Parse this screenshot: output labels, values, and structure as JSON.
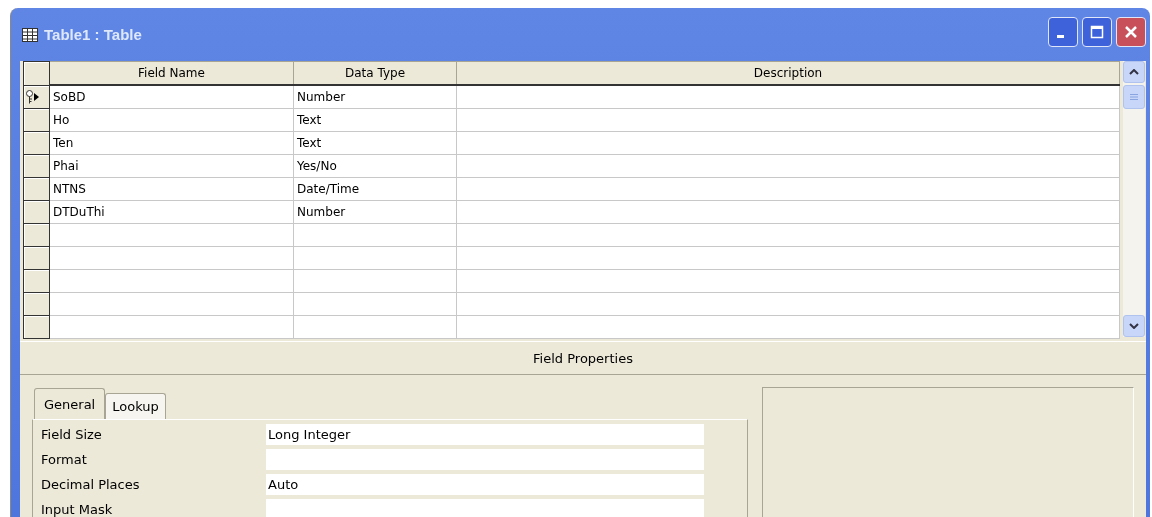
{
  "window": {
    "title": "Table1 : Table"
  },
  "grid": {
    "columns": [
      "Field Name",
      "Data Type",
      "Description"
    ],
    "rows": [
      {
        "field_name": "SoBD",
        "data_type": "Number",
        "primary_key": true,
        "current": true
      },
      {
        "field_name": "Ho",
        "data_type": "Text",
        "primary_key": false,
        "current": false
      },
      {
        "field_name": "Ten",
        "data_type": "Text",
        "primary_key": false,
        "current": false
      },
      {
        "field_name": "Phai",
        "data_type": "Yes/No",
        "primary_key": false,
        "current": false
      },
      {
        "field_name": "NTNS",
        "data_type": "Date/Time",
        "primary_key": false,
        "current": false
      },
      {
        "field_name": "DTDuThi",
        "data_type": "Number",
        "primary_key": false,
        "current": false
      }
    ]
  },
  "field_properties": {
    "title": "Field Properties",
    "tabs": [
      {
        "label": "General",
        "selected": true
      },
      {
        "label": "Lookup",
        "selected": false
      }
    ],
    "properties": [
      {
        "label": "Field Size",
        "value": "Long Integer"
      },
      {
        "label": "Format"
      },
      {
        "label": "Decimal Places",
        "value": "Auto"
      },
      {
        "label": "Input Mask"
      }
    ]
  }
}
